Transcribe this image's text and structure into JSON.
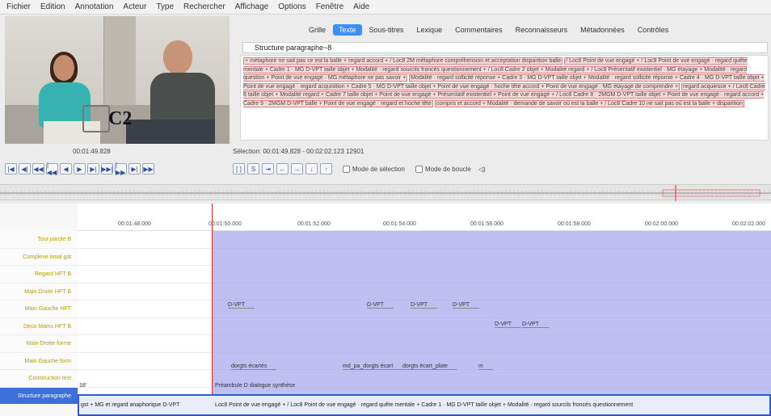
{
  "menu": [
    "Fichier",
    "Edition",
    "Annotation",
    "Acteur",
    "Type",
    "Rechercher",
    "Affichage",
    "Options",
    "Fenêtre",
    "Aide"
  ],
  "video": {
    "overlay_label": "C2"
  },
  "player": {
    "timecode": "00:01:49.828",
    "selection": "Sélection: 00:01:49.828 - 00:02:02.123  12901",
    "controls": [
      "|◀",
      "◀|",
      "◀◀",
      "|◀◀",
      "◀",
      "▶",
      "▶|",
      "▶▶|",
      "|▶▶",
      "▶|",
      "▶▶"
    ],
    "controls2": [
      "[ ]",
      "S",
      "⇥",
      "←",
      "→",
      "↓",
      "↑"
    ],
    "mode_selection": "Mode de sélection",
    "mode_boucle": "Mode de boucle"
  },
  "tabs": [
    "Grille",
    "Texte",
    "Sous-titres",
    "Lexique",
    "Commentaires",
    "Reconnaisseurs",
    "Métadonnées",
    "Contrôles"
  ],
  "active_tab": "Texte",
  "tier_select": "Structure paragraphe~8",
  "text_segments": [
    "+ métaphore ne sait pas ce est la balle + regard accord + / Loc8 2M métaphore compréhension et acceptation disparition balle",
    "/ Loc8 Point de vue engagé + / Loc8 Point de vue engagé · regard quête mentale + Cadre 1 · MG D-VPT taille objet + Modalité · regard sourcils froncés questionnement + / Loc8 Cadre 2 objet + Modalité regard + / Loc8 Présentatif existentiel · MG étayage + Modalité · regard question + Point de vue engagé · MG métaphore ne pas savoir +",
    "Modalité · regard sollicité réponse + Cadre 3 · MG D-VPT taille objet + Modalité · regard sollicité réponse + Cadre 4 · MG D-VPT taille objet + Point de vue engagé · regard acquisition + Cadre 5 · MG D-VPT taille objet + Point de vue engagé · hoche tête accord + Point de vue engagé · MG étayage de comprendre +",
    "regard acquiesce + / Loc8 Cadre 6 taille objet + Modalité regard + Cadre 7 taille objet + Point de vue engagé + Présentatif existentiel + Point de vue engagé + / Loc8 Cadre 8 · 2MGM D-VPT taille objet + Point de vue engagé · regard accord + Cadre 9 · 2MGM D-VPT balle + Point de vue engagé · regard et hoche tête",
    "compris et accord + Modalité · demande de savoir où est la balle + / Loc8 Cadre 10 ne sait pas où est la balle + disparition"
  ],
  "timeline": {
    "ticks": [
      "00:01:48.000",
      "00:01:50.000",
      "00:01:52.000",
      "00:01:54.000",
      "00:01:56.000",
      "00:01:58.000",
      "00:02:00.000",
      "00:02:02.000"
    ],
    "tiers": [
      "Tour parole B",
      "Complexe tonal gst",
      "Regard HFT B",
      "Main Droite HFT B",
      "Main Gauche HFT",
      "Deux Mains HFT B",
      "Main Droite forme",
      "Main Gauche form",
      "Construction text",
      "Structure paragraphe"
    ],
    "annotations": [
      {
        "row": 4,
        "text": "D-VPT"
      },
      {
        "row": 4,
        "text": "D-VPT"
      },
      {
        "row": 4,
        "text": "D-VPT"
      },
      {
        "row": 4,
        "text": "D-VPT"
      },
      {
        "row": 5,
        "text": "D-VPT"
      },
      {
        "row": 5,
        "text": "D-VPT"
      },
      {
        "row": 7,
        "text": "dorgts écartés"
      },
      {
        "row": 7,
        "text": "md_pa_dorgts écart"
      },
      {
        "row": 7,
        "text": "dorgts écart_plate"
      },
      {
        "row": 7,
        "text": "m"
      },
      {
        "row": 8,
        "text": "Préambule D dialogue synthèse"
      }
    ],
    "left_value": "18'",
    "bottom_text": "gst + MG et regard anaphorique D-VPT",
    "bottom_text2": "Loc8 Point de vue engagé + / Loc8 Point de vue engagé · regard quête mentale + Cadre 1 · MG D-VPT taille objet + Modalité · regard sourcils froncés questionnement"
  }
}
